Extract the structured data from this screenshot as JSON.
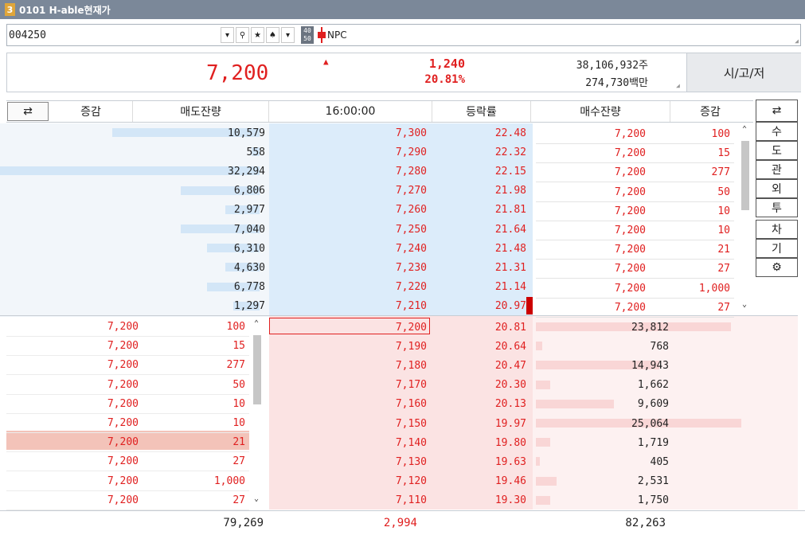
{
  "window": {
    "number": "3",
    "title": "0101 H-able현재가"
  },
  "search": {
    "code": "004250",
    "badge_top": "40",
    "badge_bottom": "50",
    "name": "NPC"
  },
  "quote": {
    "price": "7,200",
    "change": "1,240",
    "rate": "20.81%",
    "volume": "38,106,932주",
    "amount": "274,730백만",
    "ohl_button": "시/고/저"
  },
  "header": {
    "change_left": "증감",
    "ask_qty": "매도잔량",
    "time": "16:00:00",
    "rate": "등락률",
    "bid_qty": "매수잔량",
    "change_right": "증감"
  },
  "asks": [
    {
      "qty": "10,579",
      "price": "7,300",
      "rate": "22.48",
      "bar": 0.56
    },
    {
      "qty": "558",
      "price": "7,290",
      "rate": "22.32",
      "bar": 0.03
    },
    {
      "qty": "32,294",
      "price": "7,280",
      "rate": "22.15",
      "bar": 1.0
    },
    {
      "qty": "6,806",
      "price": "7,270",
      "rate": "21.98",
      "bar": 0.3
    },
    {
      "qty": "2,977",
      "price": "7,260",
      "rate": "21.81",
      "bar": 0.13
    },
    {
      "qty": "7,040",
      "price": "7,250",
      "rate": "21.64",
      "bar": 0.3
    },
    {
      "qty": "6,310",
      "price": "7,240",
      "rate": "21.48",
      "bar": 0.2
    },
    {
      "qty": "4,630",
      "price": "7,230",
      "rate": "21.31",
      "bar": 0.13
    },
    {
      "qty": "6,778",
      "price": "7,220",
      "rate": "21.14",
      "bar": 0.2
    },
    {
      "qty": "1,297",
      "price": "7,210",
      "rate": "20.97",
      "bar": 0.1
    }
  ],
  "bids": [
    {
      "price": "7,200",
      "rate": "20.81",
      "qty": "23,812",
      "bar": 0.95
    },
    {
      "price": "7,190",
      "rate": "20.64",
      "qty": "768",
      "bar": 0.03
    },
    {
      "price": "7,180",
      "rate": "20.47",
      "qty": "14,943",
      "bar": 0.6
    },
    {
      "price": "7,170",
      "rate": "20.30",
      "qty": "1,662",
      "bar": 0.07
    },
    {
      "price": "7,160",
      "rate": "20.13",
      "qty": "9,609",
      "bar": 0.38
    },
    {
      "price": "7,150",
      "rate": "19.97",
      "qty": "25,064",
      "bar": 1.0
    },
    {
      "price": "7,140",
      "rate": "19.80",
      "qty": "1,719",
      "bar": 0.07
    },
    {
      "price": "7,130",
      "rate": "19.63",
      "qty": "405",
      "bar": 0.02
    },
    {
      "price": "7,120",
      "rate": "19.46",
      "qty": "2,531",
      "bar": 0.1
    },
    {
      "price": "7,110",
      "rate": "19.30",
      "qty": "1,750",
      "bar": 0.07
    }
  ],
  "ticks_right": [
    {
      "price": "7,200",
      "qty": "100"
    },
    {
      "price": "7,200",
      "qty": "15"
    },
    {
      "price": "7,200",
      "qty": "277"
    },
    {
      "price": "7,200",
      "qty": "50"
    },
    {
      "price": "7,200",
      "qty": "10"
    },
    {
      "price": "7,200",
      "qty": "10"
    },
    {
      "price": "7,200",
      "qty": "21"
    },
    {
      "price": "7,200",
      "qty": "27"
    },
    {
      "price": "7,200",
      "qty": "1,000"
    },
    {
      "price": "7,200",
      "qty": "27"
    }
  ],
  "ticks_left": [
    {
      "price": "7,200",
      "qty": "100"
    },
    {
      "price": "7,200",
      "qty": "15"
    },
    {
      "price": "7,200",
      "qty": "277"
    },
    {
      "price": "7,200",
      "qty": "50"
    },
    {
      "price": "7,200",
      "qty": "10"
    },
    {
      "price": "7,200",
      "qty": "10"
    },
    {
      "price": "7,200",
      "qty": "21"
    },
    {
      "price": "7,200",
      "qty": "27"
    },
    {
      "price": "7,200",
      "qty": "1,000"
    },
    {
      "price": "7,200",
      "qty": "27"
    }
  ],
  "side_buttons": [
    "수",
    "도",
    "관",
    "외",
    "투",
    "차",
    "기"
  ],
  "totals": {
    "ask_total": "79,269",
    "diff": "2,994",
    "bid_total": "82,263"
  },
  "colors": {
    "up": "#e02020",
    "title_bg": "#7b8899"
  }
}
